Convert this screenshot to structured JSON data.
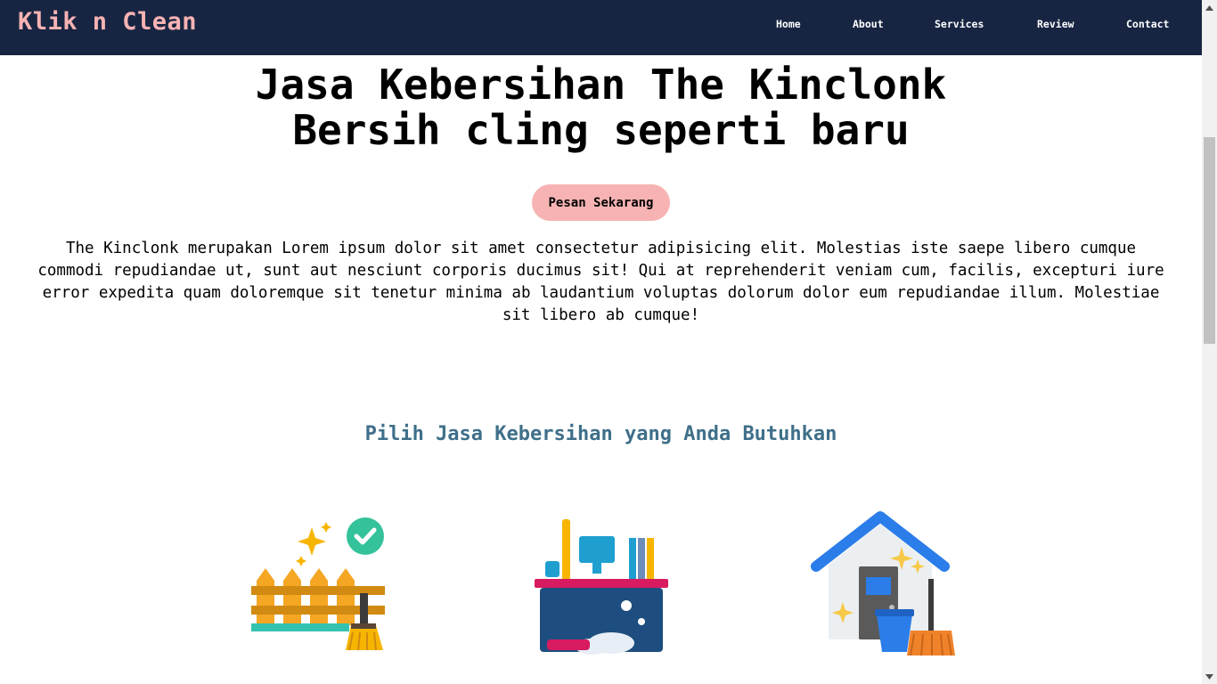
{
  "navbar": {
    "brand": "Klik n Clean",
    "links": [
      "Home",
      "About",
      "Services",
      "Review",
      "Contact"
    ]
  },
  "hero": {
    "title_line1": "Jasa Kebersihan The Kinclonk",
    "title_line2": "Bersih cling seperti baru",
    "cta_label": "Pesan Sekarang",
    "description": "The Kinclonk merupakan Lorem ipsum dolor sit amet consectetur adipisicing elit. Molestias iste saepe libero cumque commodi repudiandae ut, sunt aut nesciunt corporis ducimus sit! Qui at reprehenderit veniam cum, facilis, excepturi iure error expedita quam doloremque sit tenetur minima ab laudantium voluptas dolorum dolor eum repudiandae illum. Molestiae sit libero ab cumque!"
  },
  "services": {
    "title": "Pilih Jasa Kebersihan yang Anda Butuhkan",
    "items": [
      {
        "icon": "fence-cleaning-icon"
      },
      {
        "icon": "office-cleaning-icon"
      },
      {
        "icon": "house-cleaning-icon"
      }
    ]
  },
  "colors": {
    "navbar_bg": "#172542",
    "brand": "#f7b3b3",
    "accent": "#f7b3b3",
    "section_title": "#3f6f8a"
  }
}
